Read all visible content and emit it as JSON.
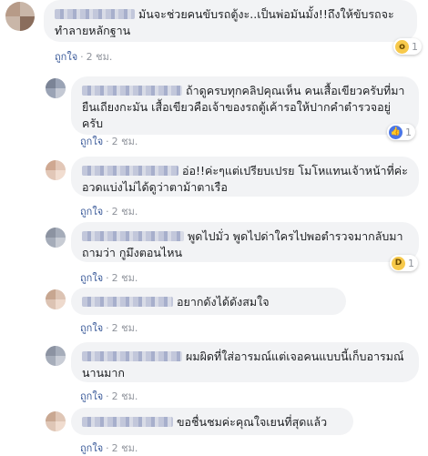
{
  "comments": [
    {
      "text": "มันจะช่วยคนขับรถตู้งะ..เป็นพ่อมันมั้ง!!ถึงให้ขับรถจะทำลายหลักฐาน",
      "reaction_count": "1",
      "reaction_icon": "wow-icon",
      "like": "ถูกใจ",
      "time": "2 ชม."
    },
    {
      "text": "ถ้าดูครบทุกคลิปคุณเห็น คนเสื้อเขียวครับที่มายืนเถียงกะมัน เสื้อเขียวคือเจ้าของรถตู้เค้ารอให้ปากคำตำรวจอยู่ครับ",
      "reaction_count": "1",
      "reaction_icon": "like-icon",
      "like": "ถูกใจ",
      "time": "2 ชม."
    },
    {
      "text": "อ่อ!!ค่ะๆแต่เปรียบเปรย โมโหแทนเจ้าหน้าที่ค่ะอวดแบ่งไม่ได้ดูว่าตาม้าตาเรือ",
      "like": "ถูกใจ",
      "time": "2 ชม."
    },
    {
      "text": "พูดไปมั่ว พูดไปด่าใครไปพอตำรวจมากลับมาถามว่า กูมึงตอนไหน",
      "reaction_count": "1",
      "reaction_icon": "haha-icon",
      "like": "ถูกใจ",
      "time": "2 ชม."
    },
    {
      "text": "อยากดังได้ดังสมใจ",
      "like": "ถูกใจ",
      "time": "2 ชม."
    },
    {
      "text": "ผมผิดที่ใส่อารมณ์แต่เจอคนแบบนี้เก็บอารมณ์นานมาก",
      "like": "ถูกใจ",
      "time": "2 ชม."
    },
    {
      "text": "ขอชื่นชมค่ะคุณใจเยนที่สุดแล้ว",
      "like": "ถูกใจ",
      "time": "2 ชม."
    }
  ],
  "colors": {
    "bubble": "#f2f3f5",
    "link": "#385898",
    "muted": "#90949c"
  }
}
